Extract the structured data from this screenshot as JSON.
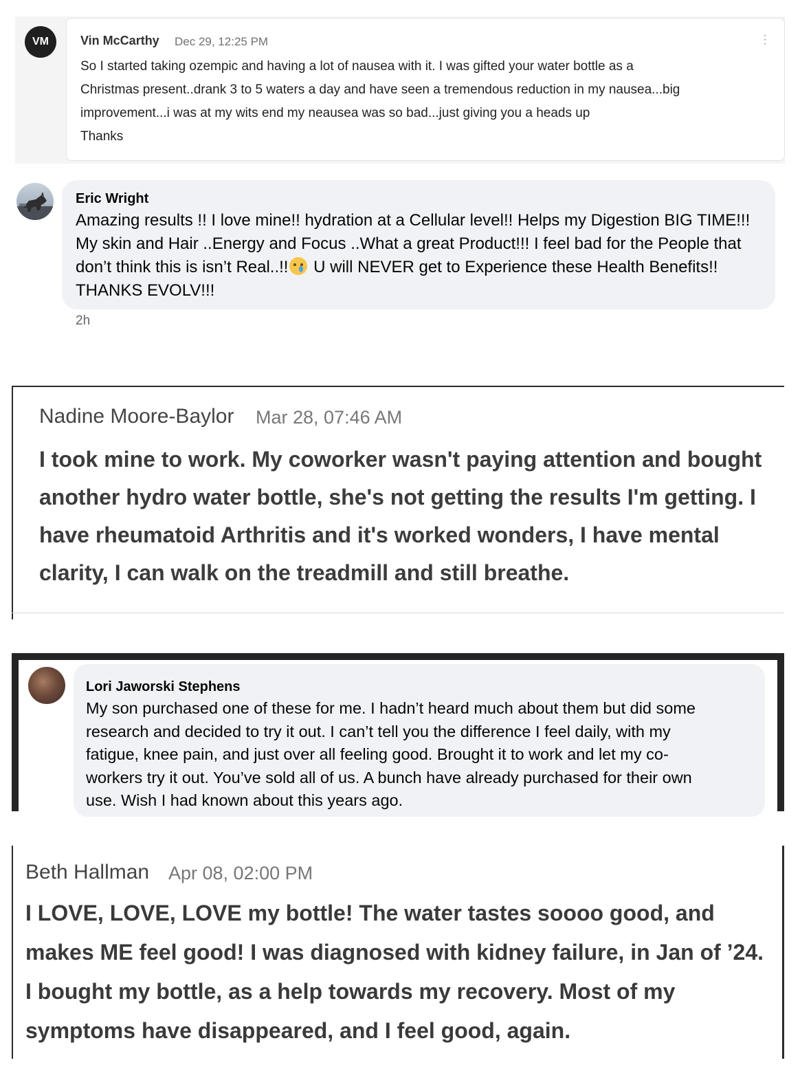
{
  "comments": [
    {
      "avatar_initials": "VM",
      "name": "Vin McCarthy",
      "time": "Dec 29, 12:25 PM",
      "lines": [
        "So I started taking ozempic and having a lot of nausea with it. I was gifted your water bottle as a",
        "Christmas present..drank 3 to 5 waters a day and have seen a tremendous reduction in my nausea...big",
        "improvement...i was at my wits end my neausea was so bad...just giving you a heads up",
        "Thanks"
      ]
    },
    {
      "name": "Eric Wright",
      "text_before_emoji": "Amazing results !! I love mine!! hydration at a Cellular level!! Helps my Digestion BIG TIME!!! My skin and Hair ..Energy and Focus ..What a great Product!!! I feel bad for the People that don’t think this is isn’t Real..!!",
      "emoji": "crying-face-emoji",
      "text_after_emoji": " U will NEVER get to Experience these Health Benefits!! THANKS EVOLV!!!",
      "time": "2h"
    },
    {
      "name": "Nadine Moore-Baylor",
      "time": "Mar 28, 07:46 AM",
      "lines": [
        "I took mine to work. My coworker wasn't paying attention and bought",
        "another hydro water bottle, she's not getting the results I'm getting. I",
        "have rheumatoid Arthritis and it's worked wonders, I have mental",
        "clarity, I can walk on the treadmill and still breathe."
      ]
    },
    {
      "name": "Lori Jaworski Stephens",
      "lines": [
        "My son purchased one of these for me. I hadn’t heard much about them but did some",
        "research and decided to try it out. I can’t tell you the difference I feel daily, with my",
        "fatigue, knee pain, and just over all feeling good. Brought it to work and let my co-",
        "workers try it out. You’ve sold all of us. A bunch have already purchased for their own",
        "use. Wish I had known about this years ago."
      ]
    },
    {
      "name": "Beth Hallman",
      "time": "Apr 08, 02:00 PM",
      "lines": [
        "I LOVE, LOVE, LOVE my bottle! The water tastes soooo good, and",
        "makes ME feel good! I was diagnosed with kidney failure, in Jan of ’24.",
        "I bought my bottle, as a help towards my recovery. Most of my",
        "symptoms have disappeared, and I feel good, again."
      ]
    }
  ],
  "icons": {
    "more": "kebab-menu-icon"
  }
}
